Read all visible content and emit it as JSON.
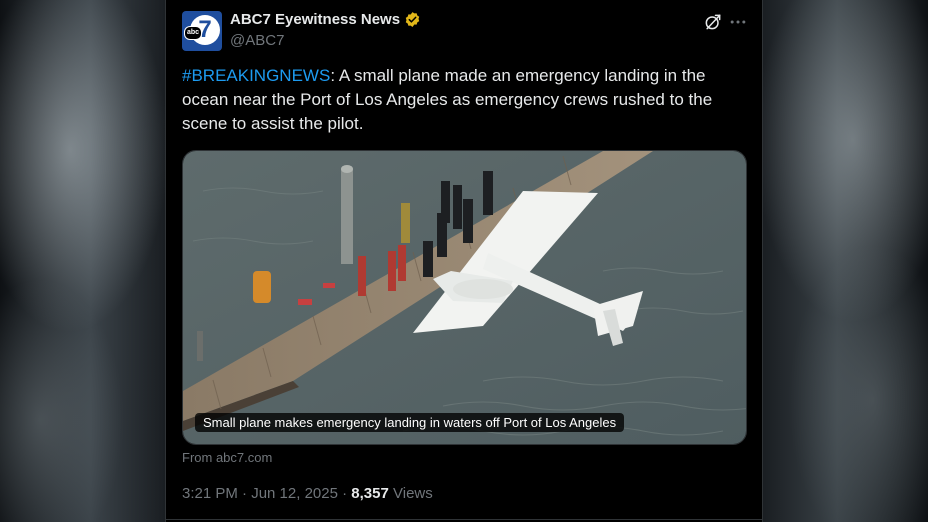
{
  "author": {
    "display_name": "ABC7 Eyewitness News",
    "handle": "@ABC7",
    "avatar_icon": "abc7-logo-icon",
    "avatar_text": "7",
    "avatar_network": "abc",
    "verified": true,
    "verified_color": "#e2b719"
  },
  "header_actions": {
    "grok_icon": "grok-icon",
    "more_icon": "more-options-icon"
  },
  "post": {
    "hashtag": "#BREAKINGNEWS",
    "body": ": A small plane made an emergency landing in the ocean near the Port of Los Angeles as emergency crews rushed to the scene to assist the pilot."
  },
  "media": {
    "caption": "Small plane makes emergency landing in waters off Port of Los Angeles",
    "source": "From abc7.com"
  },
  "meta": {
    "timestamp": "3:21 PM · Jun 12, 2025",
    "separator": "·",
    "view_count": "8,357",
    "views_label": "Views"
  },
  "colors": {
    "background": "#000000",
    "text": "#e7e9ea",
    "muted": "#71767b",
    "link": "#1d9bf0",
    "brand": "#1f4e9e"
  }
}
